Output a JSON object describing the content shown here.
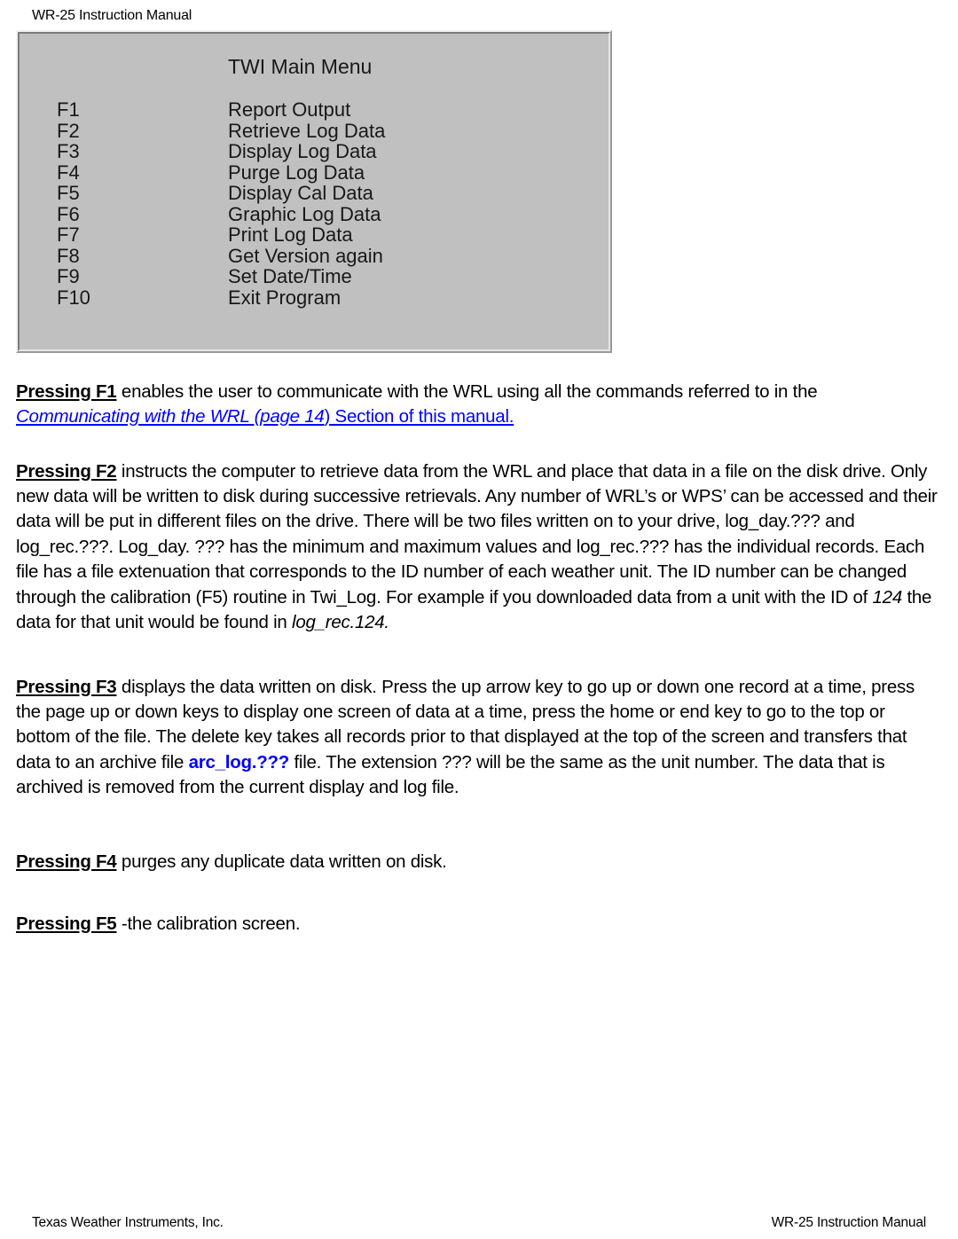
{
  "running_head": "WR-25 Instruction Manual",
  "menu_screenshot": {
    "title": "TWI Main Menu",
    "items": [
      {
        "key": "F1",
        "label": "Report Output"
      },
      {
        "key": "F2",
        "label": "Retrieve Log Data"
      },
      {
        "key": "F3",
        "label": "Display Log Data"
      },
      {
        "key": "F4",
        "label": "Purge Log Data"
      },
      {
        "key": "F5",
        "label": "Display Cal Data"
      },
      {
        "key": "F6",
        "label": "Graphic Log Data"
      },
      {
        "key": "F7",
        "label": "Print Log Data"
      },
      {
        "key": "F8",
        "label": "Get Version again"
      },
      {
        "key": "F9",
        "label": "Set Date/Time"
      },
      {
        "key": "F10",
        "label": "Exit Program"
      }
    ],
    "background_color": "#c0c0c0"
  },
  "paragraphs": {
    "f1": {
      "lead": "Pressing F1",
      "text_a": " enables the user to communicate with the WRL using all the commands referred to in the ",
      "link_italic": "Communicating with the WRL (page 14",
      "link_plain": ") Section of this manual.",
      "link_color": "#0000ff"
    },
    "f2": {
      "lead": "Pressing F2",
      "text_a": " instructs the computer to retrieve data from the WRL and place that data in a file on the disk drive. Only new data will be written to disk during successive retrievals. Any number of WRL’s or WPS’ can be accessed and their data will be put in different files on the drive. There will be two files written on to your drive, log_day.??? and log_rec.???. Log_day. ??? has the minimum and maximum values and log_rec.??? has the individual records. Each file has a file extenuation that corresponds to the ID number of each weather unit. The ID number can be changed through the calibration (F5) routine in Twi_Log. For example if you downloaded data from a unit with the ID of ",
      "italic_a": "124",
      "text_b": " the data for that unit would be found in ",
      "italic_b": "log_rec.124.",
      "text_c": ""
    },
    "f3": {
      "lead": "Pressing F3",
      "text_a": " displays the data written on disk. Press the up arrow key to go up or down one record at a time, press the page up or down keys to display one screen of data at a time, press the home or end key to go to the top or bottom of the file. The delete key takes all records prior to that displayed at the top of the screen and transfers that data to an archive file ",
      "highlight": "arc_log.???",
      "highlight_color": "#0000ff",
      "text_b": " file. The extension ??? will be the same as the unit number. The data that is archived is removed from the current display and log file."
    },
    "f4": {
      "lead": "Pressing F4",
      "text_a": " purges any duplicate data written on disk."
    },
    "f5": {
      "lead": "Pressing F5",
      "text_a": " -the calibration screen."
    }
  },
  "footer": {
    "left": "Texas Weather Instruments, Inc.",
    "right": "WR-25 Instruction Manual"
  }
}
